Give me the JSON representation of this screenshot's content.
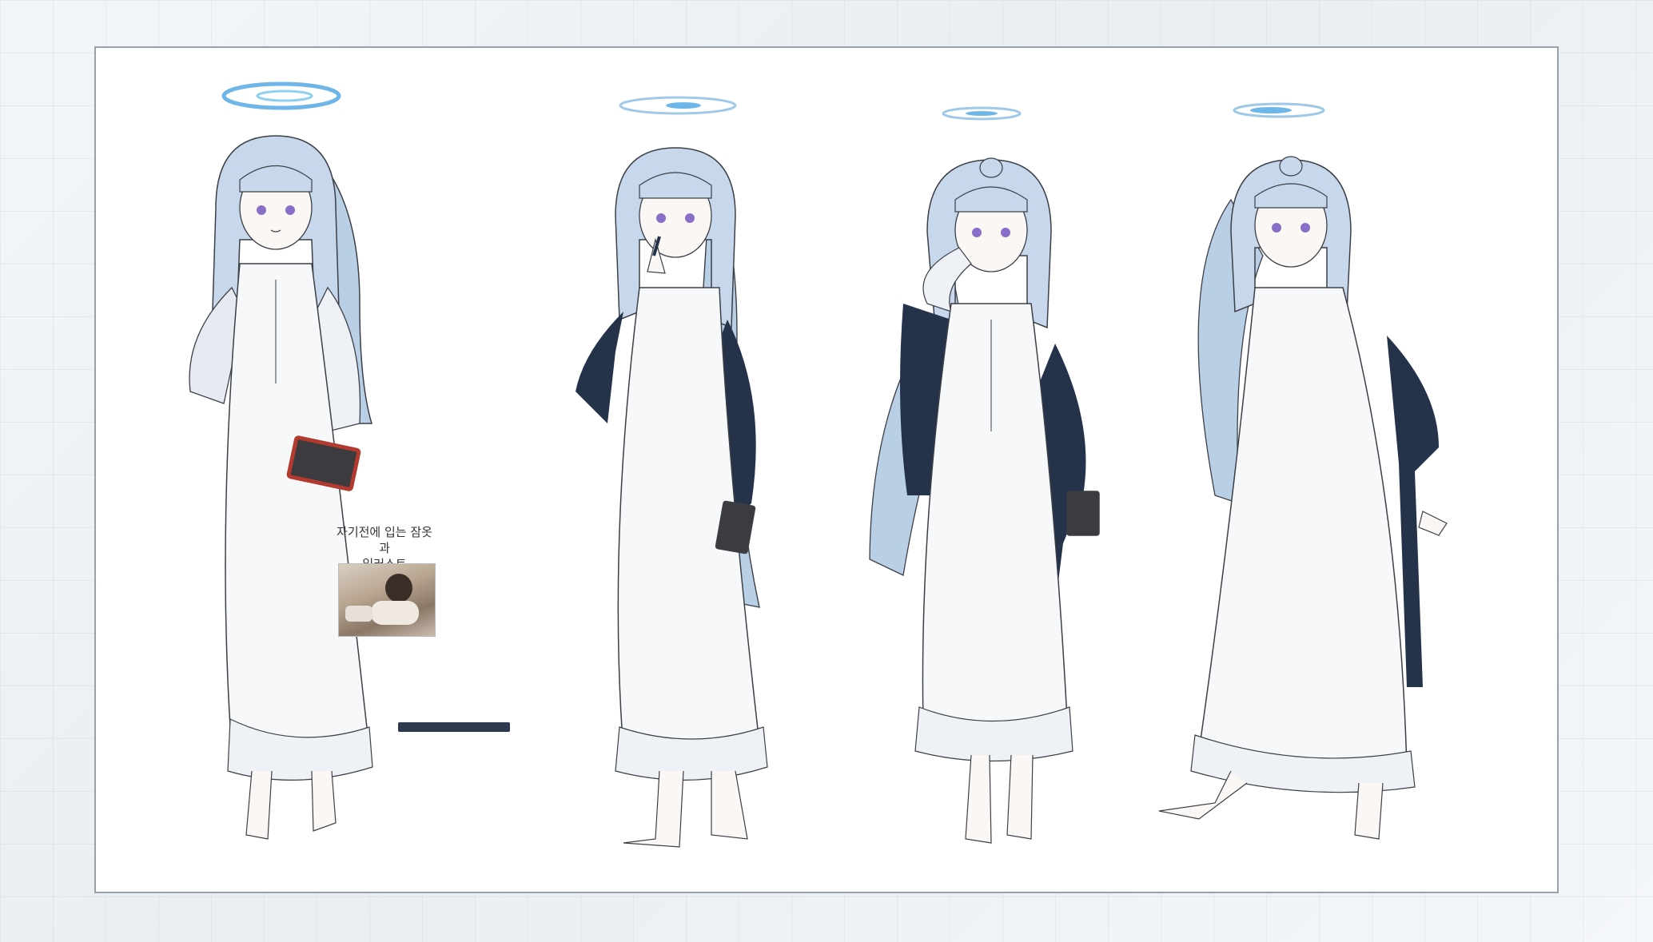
{
  "canvas": {
    "background": "#eef2f5",
    "sheet_color": "#ffffff",
    "border_color": "#9aa0a6"
  },
  "figures": [
    {
      "label": "figure-1-ponytail-holding-book",
      "halo_color": "#6fb6e8"
    },
    {
      "label": "figure-2-shawl-pen",
      "halo_color": "#6fb6e8"
    },
    {
      "label": "figure-3-shawl-hand-on-cheek",
      "halo_color": "#6fb6e8"
    },
    {
      "label": "figure-4-shawl-walking",
      "halo_color": "#6fb6e8"
    }
  ],
  "palette": {
    "hair": "#b9cfe6",
    "hair_shade": "#8eaad0",
    "dress": "#f6f8fa",
    "dress_shade": "#d8dee6",
    "shawl": "#24324a",
    "book_red": "#b23a2e",
    "book_dark": "#3b3b40",
    "eye": "#8a6fc8",
    "line": "#3c3f46"
  },
  "annotation": {
    "note_line1": "자기전에 입는 잠옷과",
    "note_line2": "일러스트"
  }
}
